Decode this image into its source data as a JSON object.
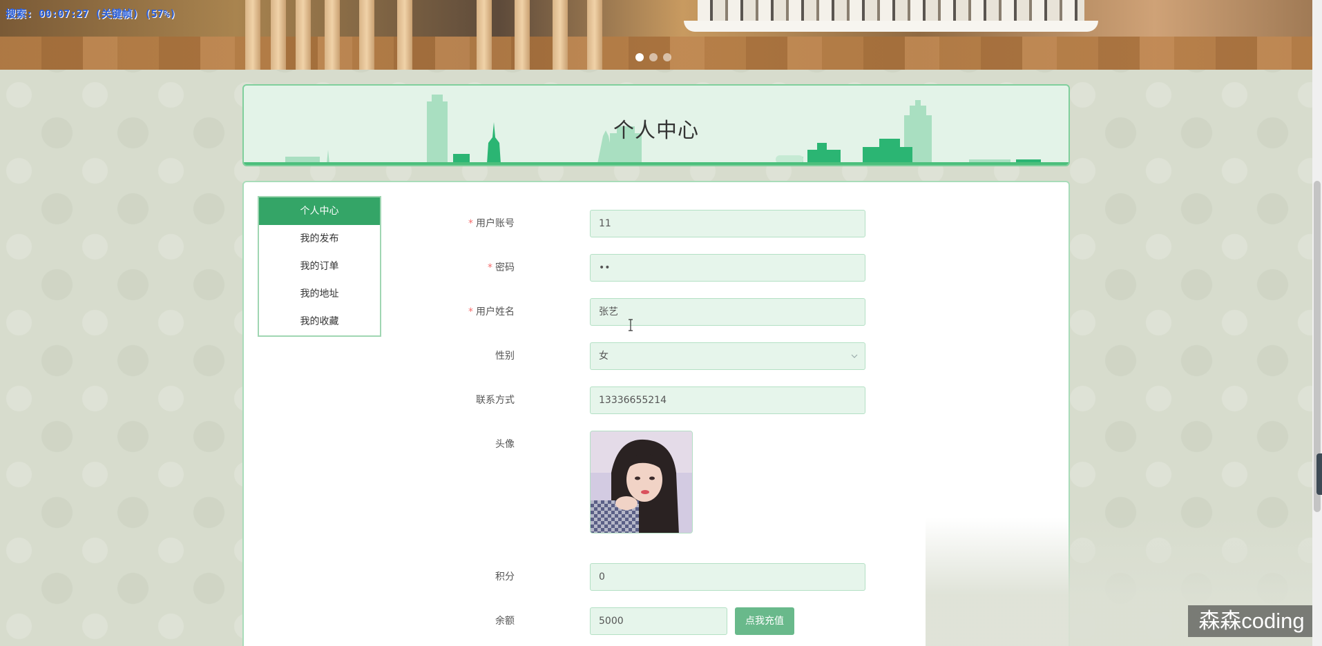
{
  "recording_overlay": "搜索: 00:07:27 (关键帧) (57%)",
  "banner": {
    "slides": 3,
    "active_slide": 1
  },
  "header": {
    "title": "个人中心"
  },
  "side_menu": {
    "items": [
      {
        "label": "个人中心",
        "active": true
      },
      {
        "label": "我的发布",
        "active": false
      },
      {
        "label": "我的订单",
        "active": false
      },
      {
        "label": "我的地址",
        "active": false
      },
      {
        "label": "我的收藏",
        "active": false
      }
    ]
  },
  "form": {
    "account": {
      "label": "用户账号",
      "required": "*",
      "value": "11"
    },
    "password": {
      "label": "密码",
      "required": "*",
      "value": "••"
    },
    "name": {
      "label": "用户姓名",
      "required": "*",
      "value": "张艺"
    },
    "gender": {
      "label": "性别",
      "value": "女"
    },
    "contact": {
      "label": "联系方式",
      "value": "13336655214"
    },
    "avatar": {
      "label": "头像"
    },
    "points": {
      "label": "积分",
      "value": "0"
    },
    "balance": {
      "label": "余额",
      "value": "5000",
      "button": "点我充值"
    }
  },
  "watermark": "森森coding",
  "colors": {
    "accent": "#34a567",
    "field_bg": "#e6f5eb",
    "required": "#f56c6c"
  }
}
